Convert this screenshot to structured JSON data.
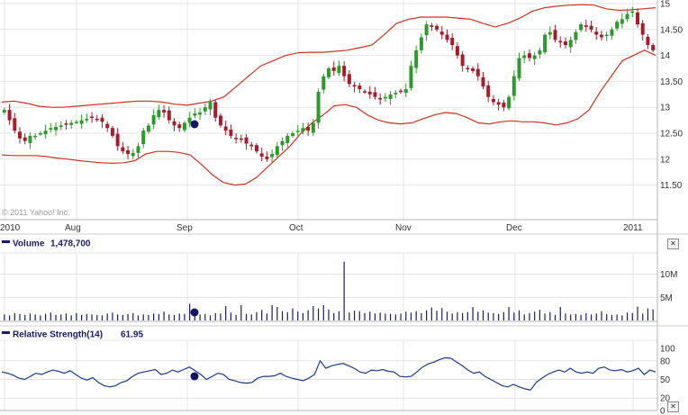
{
  "chart_data": [
    {
      "type": "candlestick",
      "x_ticks": [
        "2010",
        "Aug",
        "Sep",
        "Oct",
        "Nov",
        "Dec",
        "2011"
      ],
      "y_ticks": [
        "15",
        "14.50",
        "14",
        "13.50",
        "13",
        "12.50",
        "12",
        "11.50"
      ],
      "ylim": [
        11.0,
        15.0
      ],
      "grid": true,
      "overlay": "Bollinger Bands",
      "series": [
        {
          "name": "close",
          "values": [
            12.95,
            12.75,
            12.55,
            12.4,
            12.35,
            12.45,
            12.45,
            12.5,
            12.55,
            12.6,
            12.62,
            12.65,
            12.68,
            12.7,
            12.72,
            12.75,
            12.78,
            12.8,
            12.78,
            12.72,
            12.6,
            12.45,
            12.25,
            12.15,
            12.1,
            12.12,
            12.25,
            12.55,
            12.65,
            12.85,
            12.95,
            12.9,
            12.75,
            12.65,
            12.6,
            12.7,
            12.8,
            12.88,
            12.9,
            13.0,
            13.1,
            12.8,
            12.65,
            12.55,
            12.45,
            12.4,
            12.38,
            12.3,
            12.25,
            12.15,
            12.05,
            12.0,
            12.1,
            12.25,
            12.35,
            12.45,
            12.5,
            12.55,
            12.6,
            12.55,
            12.7,
            13.3,
            13.6,
            13.75,
            13.7,
            13.8,
            13.6,
            13.45,
            13.4,
            13.35,
            13.3,
            13.25,
            13.2,
            13.15,
            13.2,
            13.25,
            13.28,
            13.3,
            13.35,
            13.8,
            14.1,
            14.35,
            14.6,
            14.55,
            14.5,
            14.4,
            14.3,
            14.2,
            14.0,
            13.8,
            13.75,
            13.7,
            13.6,
            13.4,
            13.2,
            13.1,
            13.05,
            13.0,
            13.2,
            13.6,
            13.95,
            14.0,
            13.95,
            14.0,
            14.1,
            14.4,
            14.45,
            14.3,
            14.25,
            14.2,
            14.3,
            14.45,
            14.6,
            14.55,
            14.5,
            14.4,
            14.35,
            14.4,
            14.5,
            14.65,
            14.7,
            14.8,
            14.85,
            14.6,
            14.4,
            14.2,
            14.1
          ]
        },
        {
          "name": "upper band",
          "values": [
            13.1,
            13.12,
            13.08,
            13.02,
            13.0,
            13.0,
            13.02,
            13.04,
            13.06,
            13.08,
            13.1,
            13.12,
            13.12,
            13.1,
            13.06,
            13.04,
            13.08,
            13.12,
            13.2,
            13.4,
            13.6,
            13.8,
            13.9,
            14.0,
            14.05,
            14.06,
            14.06,
            14.08,
            14.1,
            14.15,
            14.2,
            14.4,
            14.62,
            14.7,
            14.74,
            14.74,
            14.74,
            14.72,
            14.7,
            14.62,
            14.55,
            14.62,
            14.72,
            14.85,
            14.92,
            14.95,
            14.97,
            14.98,
            14.97,
            14.9,
            14.87,
            14.88,
            14.9,
            14.92
          ]
        },
        {
          "name": "lower band",
          "values": [
            12.08,
            12.07,
            12.07,
            12.07,
            12.05,
            12.02,
            12.0,
            11.97,
            11.95,
            11.93,
            11.92,
            11.93,
            11.97,
            12.1,
            12.15,
            12.15,
            12.13,
            12.08,
            11.9,
            11.7,
            11.55,
            11.5,
            11.52,
            11.65,
            11.85,
            12.05,
            12.25,
            12.5,
            12.7,
            12.85,
            13.03,
            13.05,
            13.0,
            12.85,
            12.75,
            12.7,
            12.68,
            12.7,
            12.78,
            12.85,
            12.9,
            12.88,
            12.8,
            12.7,
            12.68,
            12.72,
            12.74,
            12.72,
            12.72,
            12.7,
            12.66,
            12.7,
            12.78,
            12.95,
            13.3,
            13.6,
            13.9,
            14.0,
            14.1,
            14.0
          ]
        }
      ]
    },
    {
      "type": "bar",
      "title": "Volume",
      "value_label": "1,478,700",
      "y_ticks": [
        "10M",
        "5M"
      ],
      "ylim": [
        0,
        14000000
      ],
      "values": [
        1300000,
        1100000,
        1600000,
        1400000,
        1200000,
        1500000,
        1300000,
        1100000,
        1400000,
        1700000,
        1200000,
        1300000,
        1500000,
        1100000,
        1600000,
        1200000,
        1400000,
        1300000,
        1200000,
        1100000,
        1500000,
        1700000,
        1300000,
        1200000,
        1400000,
        1600000,
        1100000,
        1300000,
        1200000,
        1500000,
        1400000,
        1900000,
        1300000,
        1200000,
        1500000,
        1400000,
        3600000,
        1200000,
        1300000,
        1400000,
        1100000,
        1600000,
        1500000,
        3100000,
        1700000,
        1200000,
        3300000,
        1400000,
        1300000,
        1800000,
        2300000,
        1500000,
        3300000,
        2900000,
        2000000,
        1800000,
        2600000,
        1900000,
        1600000,
        2200000,
        3100000,
        2600000,
        3300000,
        2400000,
        1600000,
        2000000,
        12700000,
        1700000,
        2100000,
        2000000,
        1600000,
        1900000,
        1500000,
        1700000,
        1500000,
        1400000,
        1300000,
        1500000,
        1900000,
        1700000,
        2000000,
        1600000,
        2200000,
        2800000,
        2100000,
        2700000,
        1900000,
        1500000,
        1800000,
        1600000,
        1800000,
        2900000,
        1900000,
        2200000,
        1700000,
        1600000,
        1400000,
        1800000,
        2900000,
        1700000,
        2200000,
        1300000,
        1600000,
        1900000,
        2300000,
        1500000,
        1800000,
        1200000,
        2900000,
        1500000,
        1300000,
        1400000,
        1200000,
        1600000,
        1300000,
        1500000,
        2000000,
        1400000,
        1200000,
        1300000,
        1100000,
        1700000,
        1600000,
        3000000,
        1500000,
        2600000,
        2400000
      ]
    },
    {
      "type": "line",
      "title": "Relative Strength(14)",
      "value_label": "61.95",
      "y_ticks": [
        "100",
        "80",
        "50",
        "20",
        "0"
      ],
      "ylim": [
        0,
        100
      ],
      "values": [
        62,
        60,
        57,
        52,
        50,
        55,
        60,
        58,
        62,
        65,
        63,
        60,
        64,
        58,
        52,
        49,
        53,
        45,
        40,
        38,
        40,
        45,
        48,
        55,
        60,
        62,
        64,
        66,
        58,
        60,
        65,
        62,
        66,
        70,
        64,
        58,
        50,
        55,
        60,
        58,
        50,
        48,
        45,
        44,
        45,
        52,
        55,
        55,
        56,
        60,
        55,
        52,
        50,
        48,
        52,
        58,
        80,
        68,
        72,
        74,
        76,
        72,
        68,
        62,
        60,
        65,
        64,
        66,
        63,
        62,
        55,
        54,
        55,
        62,
        70,
        75,
        78,
        82,
        85,
        84,
        78,
        72,
        65,
        60,
        62,
        55,
        50,
        45,
        40,
        38,
        42,
        38,
        35,
        33,
        45,
        52,
        58,
        62,
        65,
        62,
        68,
        62,
        60,
        62,
        60,
        68,
        70,
        65,
        64,
        66,
        62,
        64,
        68,
        58,
        65,
        62
      ]
    }
  ],
  "copyright": "© 2011 Yahoo! Inc.",
  "close_glyph": "✕",
  "colors": {
    "up": "#2e9a2e",
    "down": "#a81c2c",
    "band": "#cc3322",
    "volume": "#1a1a6e",
    "rsi": "#1a3a8e",
    "grid": "#e4e4e4"
  }
}
